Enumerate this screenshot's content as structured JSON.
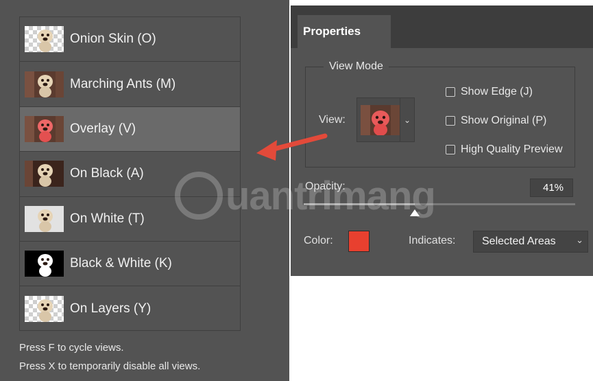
{
  "view_modes": [
    {
      "label": "Onion Skin (O)",
      "thumb": "checker-dog",
      "selected": false
    },
    {
      "label": "Marching Ants (M)",
      "thumb": "photo-dog",
      "selected": false
    },
    {
      "label": "Overlay (V)",
      "thumb": "overlay-dog",
      "selected": true
    },
    {
      "label": "On Black (A)",
      "thumb": "black-dog",
      "selected": false
    },
    {
      "label": "On White (T)",
      "thumb": "white-dog",
      "selected": false
    },
    {
      "label": "Black & White (K)",
      "thumb": "mask-dog",
      "selected": false
    },
    {
      "label": "On Layers (Y)",
      "thumb": "checker-dog",
      "selected": false
    }
  ],
  "hints": {
    "cycle": "Press F to cycle views.",
    "disable": "Press X to temporarily disable all views."
  },
  "properties": {
    "tab": "Properties",
    "view_mode_legend": "View Mode",
    "view_label": "View:",
    "show_edge": "Show Edge (J)",
    "show_original": "Show Original (P)",
    "high_quality": "High Quality Preview",
    "opacity_label": "Opacity:",
    "opacity_value": "41%",
    "opacity_fraction": 0.41,
    "color_label": "Color:",
    "overlay_color": "#e8402f",
    "indicates_label": "Indicates:",
    "indicates_value": "Selected Areas"
  },
  "watermark": "uantrimang",
  "colors": {
    "panel": "#535353",
    "selected_row": "#6a6a6a",
    "arrow": "#e34a3a"
  }
}
